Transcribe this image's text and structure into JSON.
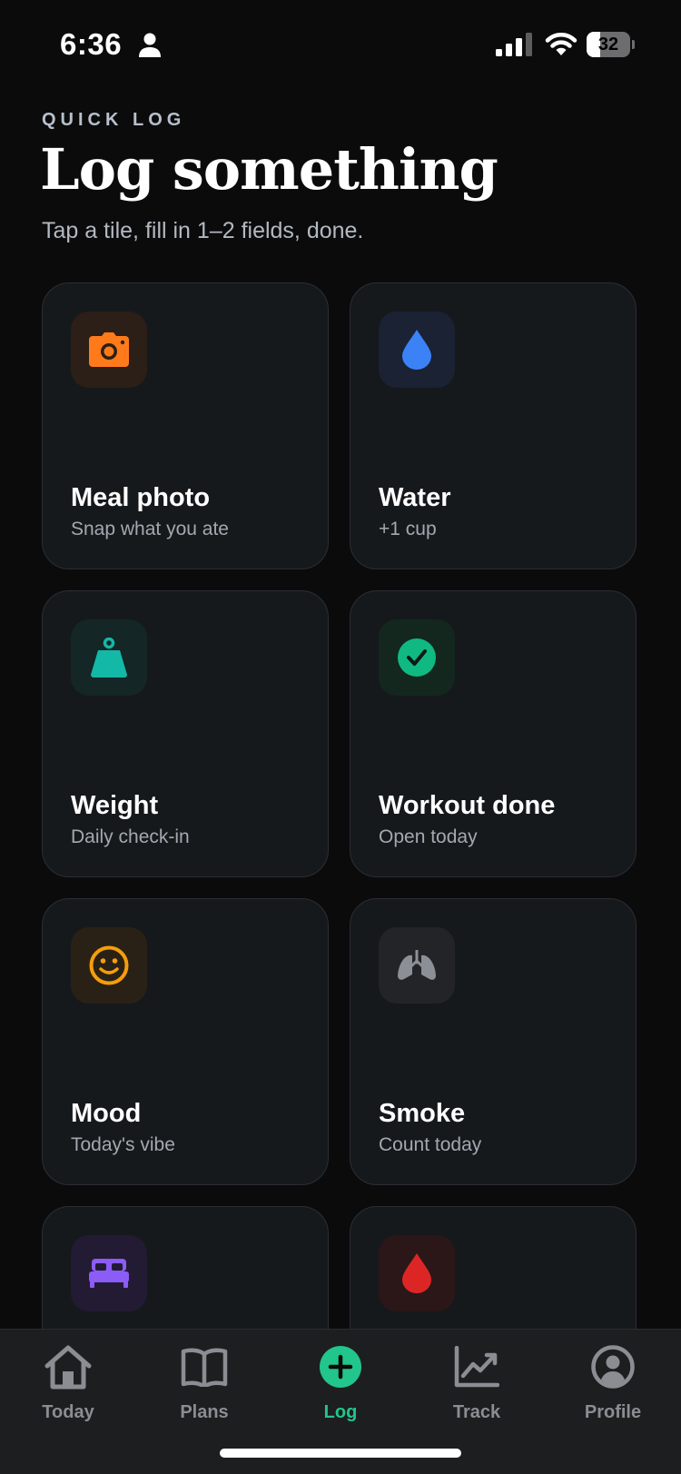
{
  "status_bar": {
    "time": "6:36",
    "battery": "32",
    "battery_level": 0.32
  },
  "header": {
    "eyebrow": "QUICK LOG",
    "title": "Log something",
    "subtitle": "Tap a tile, fill in 1–2 fields, done."
  },
  "tiles": [
    {
      "title": "Meal photo",
      "subtitle": "Snap what you ate",
      "icon": "camera-icon",
      "icon_color": "#ff7a1a",
      "icon_bg": "#2b1f17"
    },
    {
      "title": "Water",
      "subtitle": "+1 cup",
      "icon": "water-drop-icon",
      "icon_color": "#3b82f6",
      "icon_bg": "#1a2233"
    },
    {
      "title": "Weight",
      "subtitle": "Daily check-in",
      "icon": "weight-icon",
      "icon_color": "#14b8a6",
      "icon_bg": "#142625"
    },
    {
      "title": "Workout done",
      "subtitle": "Open today",
      "icon": "checkmark-icon",
      "icon_color": "#10b981",
      "icon_bg": "#13271f"
    },
    {
      "title": "Mood",
      "subtitle": "Today's vibe",
      "icon": "smiley-icon",
      "icon_color": "#f59e0b",
      "icon_bg": "#2a2116"
    },
    {
      "title": "Smoke",
      "subtitle": "Count today",
      "icon": "lungs-icon",
      "icon_color": "#8b8f96",
      "icon_bg": "#222427"
    },
    {
      "title": "",
      "subtitle": "",
      "icon": "bed-icon",
      "icon_color": "#8b5cf6",
      "icon_bg": "#221b33"
    },
    {
      "title": "",
      "subtitle": "",
      "icon": "blood-drop-icon",
      "icon_color": "#dc2626",
      "icon_bg": "#2b1718"
    }
  ],
  "tab_bar": {
    "active": "Log",
    "active_color": "#22c58b",
    "tabs": [
      {
        "label": "Today",
        "icon": "home-icon"
      },
      {
        "label": "Plans",
        "icon": "book-icon"
      },
      {
        "label": "Log",
        "icon": "plus-circle-icon"
      },
      {
        "label": "Track",
        "icon": "chart-trend-icon"
      },
      {
        "label": "Profile",
        "icon": "profile-icon"
      }
    ]
  }
}
